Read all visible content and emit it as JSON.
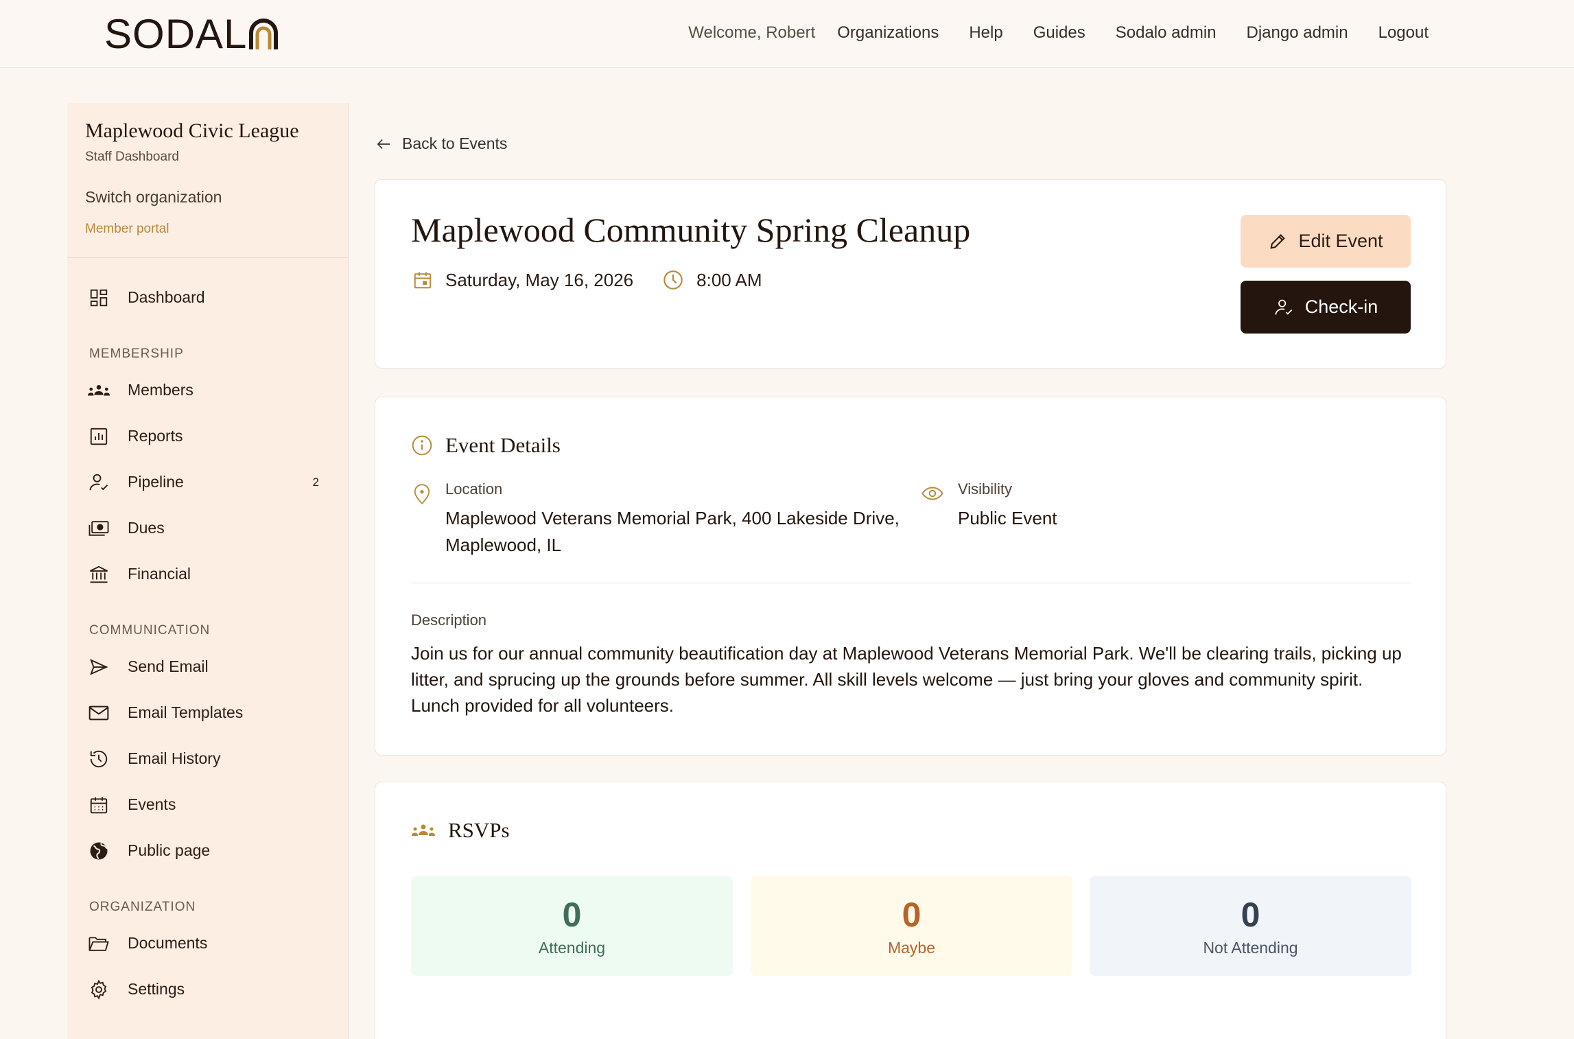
{
  "header": {
    "logo": "SODALO",
    "welcome": "Welcome, Robert",
    "nav": [
      "Organizations",
      "Help",
      "Guides",
      "Sodalo admin",
      "Django admin",
      "Logout"
    ]
  },
  "sidebar": {
    "org_name": "Maplewood Civic League",
    "org_sub": "Staff Dashboard",
    "switch_label": "Switch organization",
    "portal_label": "Member portal",
    "dashboard": "Dashboard",
    "membership_label": "MEMBERSHIP",
    "members": "Members",
    "reports": "Reports",
    "pipeline": "Pipeline",
    "pipeline_badge": "2",
    "dues": "Dues",
    "financial": "Financial",
    "communication_label": "COMMUNICATION",
    "send_email": "Send Email",
    "email_templates": "Email Templates",
    "email_history": "Email History",
    "events": "Events",
    "public_page": "Public page",
    "organization_label": "ORGANIZATION",
    "documents": "Documents",
    "settings": "Settings"
  },
  "main": {
    "back_label": "Back to Events",
    "event": {
      "title": "Maplewood Community Spring Cleanup",
      "date": "Saturday, May 16, 2026",
      "time": "8:00 AM",
      "edit_label": "Edit Event",
      "checkin_label": "Check-in"
    },
    "details": {
      "heading": "Event Details",
      "location_label": "Location",
      "location_line1": "Maplewood Veterans Memorial Park, 400 Lakeside Drive,",
      "location_line2": "Maplewood, IL",
      "visibility_label": "Visibility",
      "visibility_value": "Public Event",
      "description_label": "Description",
      "description": "Join us for our annual community beautification day at Maplewood Veterans Memorial Park. We'll be clearing trails, picking up litter, and sprucing up the grounds before summer. All skill levels welcome — just bring your gloves and community spirit. Lunch provided for all volunteers."
    },
    "rsvps": {
      "heading": "RSVPs",
      "attending_count": "0",
      "attending_label": "Attending",
      "maybe_count": "0",
      "maybe_label": "Maybe",
      "not_attending_count": "0",
      "not_attending_label": "Not Attending"
    }
  },
  "colors": {
    "accent": "#b8893a",
    "dark_button": "#24160e",
    "edit_button": "#fbdcc2",
    "sidebar_bg": "#fdeee3"
  }
}
